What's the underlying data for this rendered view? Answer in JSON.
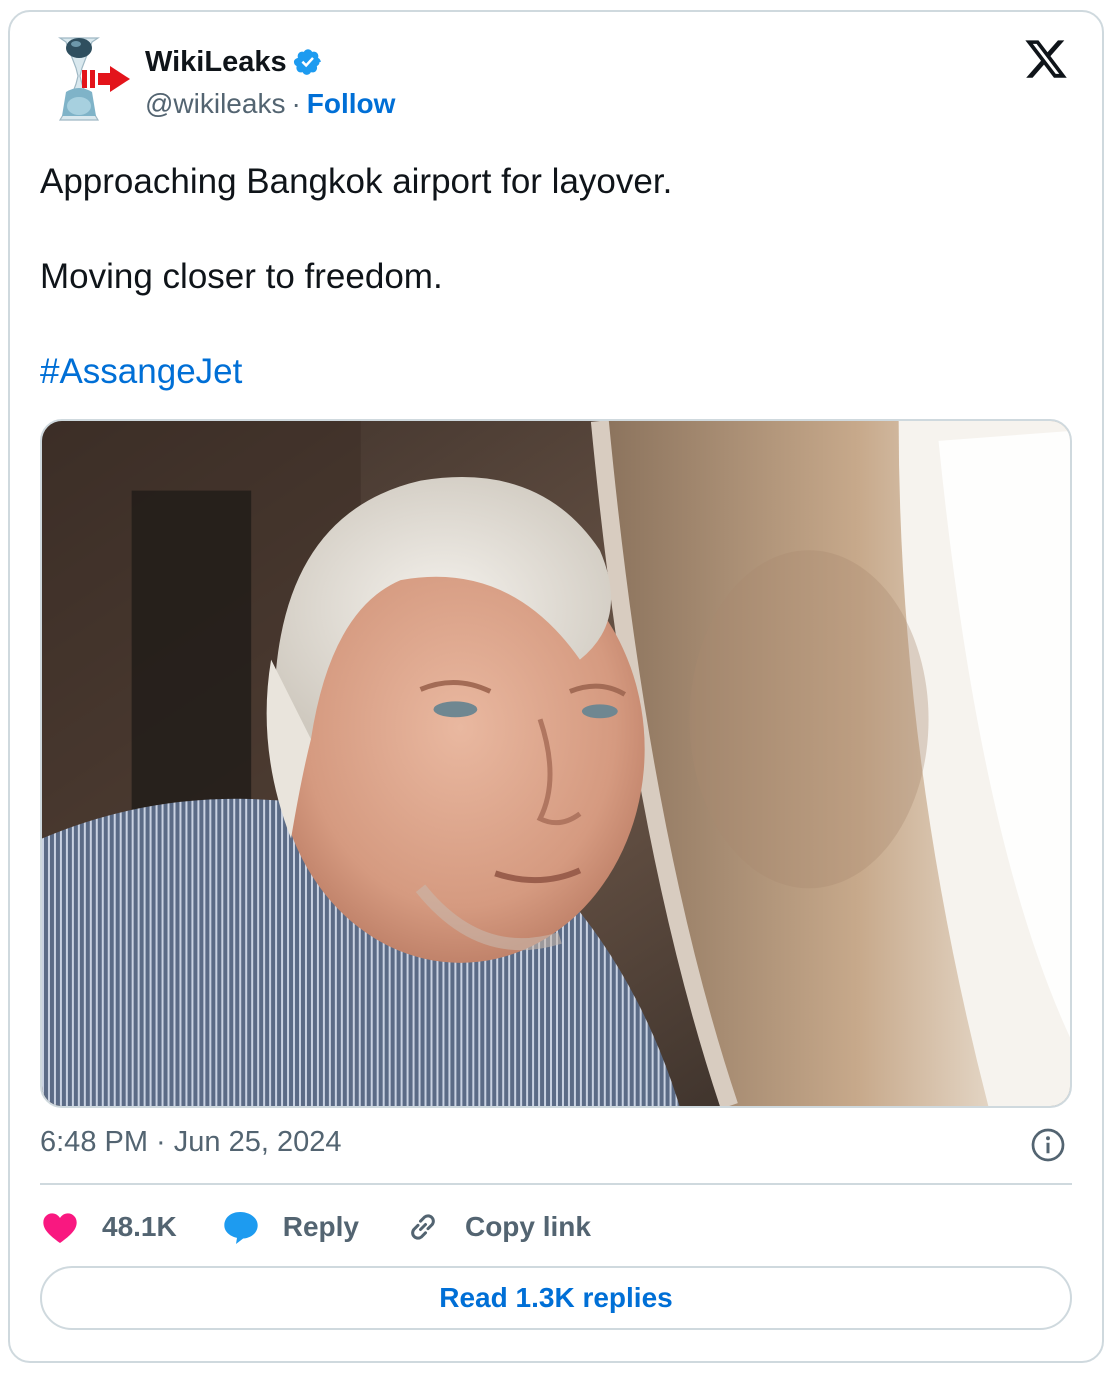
{
  "author": {
    "name": "WikiLeaks",
    "handle": "@wikileaks",
    "separator": "·",
    "follow_label": "Follow",
    "avatar_icon": "wikileaks-hourglass-logo-with-red-arrow",
    "verified_icon": "verified-badge-icon"
  },
  "platform_icon": "x-logo",
  "tweet": {
    "line1": "Approaching Bangkok airport for layover.",
    "line2": "Moving closer to freedom.",
    "hashtag": "#AssangeJet"
  },
  "media": {
    "icon": "photo-man-looking-out-airplane-window"
  },
  "meta": {
    "timestamp": "6:48 PM · Jun 25, 2024"
  },
  "actions": {
    "likes": "48.1K",
    "reply_label": "Reply",
    "copy_label": "Copy link"
  },
  "read_replies_label": "Read 1.3K replies",
  "colors": {
    "accent": "#006fd6",
    "like": "#f91880",
    "reply_bubble": "#1d9bf0",
    "muted": "#536471",
    "border": "#cfd9de"
  }
}
